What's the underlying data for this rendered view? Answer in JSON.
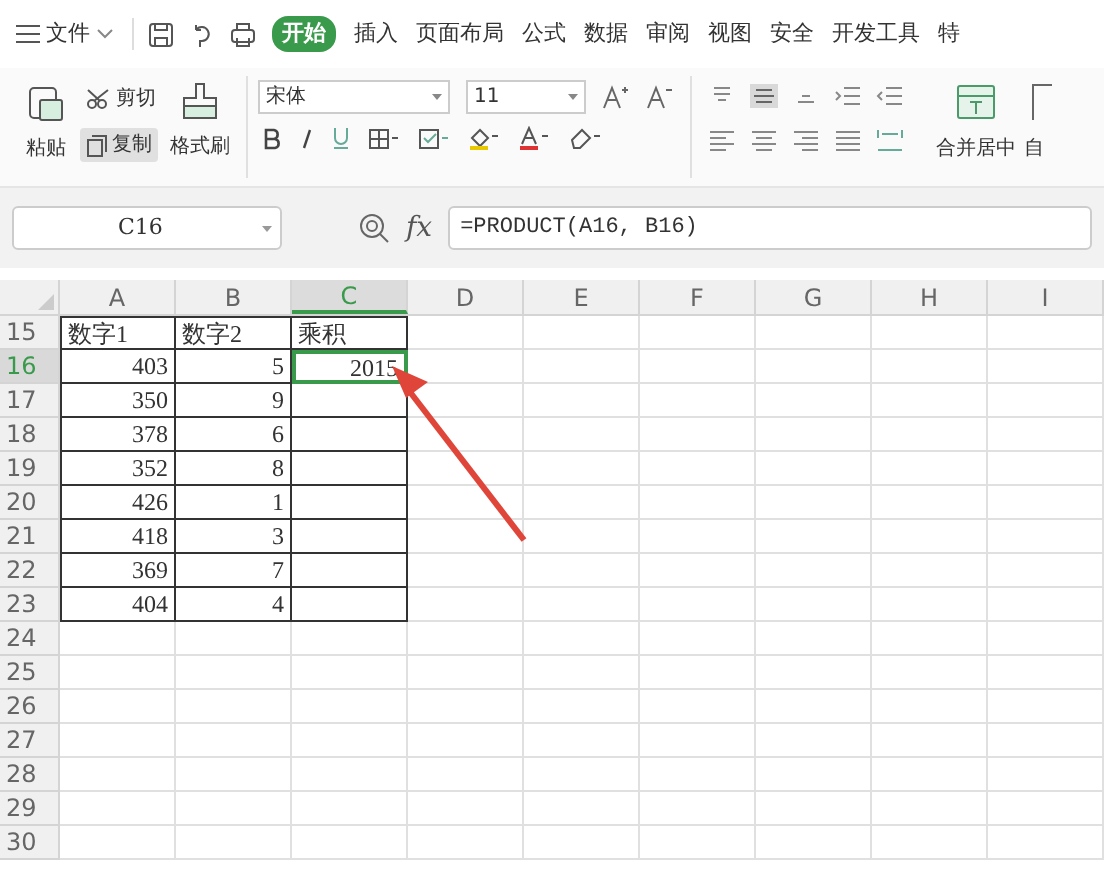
{
  "menu_bar": {
    "file_label": "文件",
    "tabs": [
      {
        "label": "开始",
        "selected": true
      },
      {
        "label": "插入",
        "selected": false
      },
      {
        "label": "页面布局",
        "selected": false
      },
      {
        "label": "公式",
        "selected": false
      },
      {
        "label": "数据",
        "selected": false
      },
      {
        "label": "审阅",
        "selected": false
      },
      {
        "label": "视图",
        "selected": false
      },
      {
        "label": "安全",
        "selected": false
      },
      {
        "label": "开发工具",
        "selected": false
      },
      {
        "label": "特",
        "selected": false
      }
    ]
  },
  "ribbon": {
    "paste": "粘贴",
    "cut": "剪切",
    "copy": "复制",
    "format_painter": "格式刷",
    "font_name": "宋体",
    "font_size": "11",
    "merge_center": "合并居中",
    "auto_wrap": "自"
  },
  "formula_bar": {
    "name_box": "C16",
    "fx_label": "fx",
    "formula": "=PRODUCT(A16, B16)"
  },
  "table": {
    "columns": [
      {
        "label": "A",
        "selected": false
      },
      {
        "label": "B",
        "selected": false
      },
      {
        "label": "C",
        "selected": true
      },
      {
        "label": "D",
        "selected": false
      },
      {
        "label": "E",
        "selected": false
      },
      {
        "label": "F",
        "selected": false
      },
      {
        "label": "G",
        "selected": false
      },
      {
        "label": "H",
        "selected": false
      },
      {
        "label": "I",
        "selected": false
      }
    ],
    "rows": [
      {
        "number": "15",
        "selected": false,
        "bordered": true,
        "kind": "label",
        "cells": [
          "数字1",
          "数字2",
          "乘积"
        ]
      },
      {
        "number": "16",
        "selected": true,
        "bordered": true,
        "kind": "number",
        "cells": [
          "403",
          "5",
          "2015"
        ]
      },
      {
        "number": "17",
        "selected": false,
        "bordered": true,
        "kind": "number",
        "cells": [
          "350",
          "9"
        ]
      },
      {
        "number": "18",
        "selected": false,
        "bordered": true,
        "kind": "number",
        "cells": [
          "378",
          "6"
        ]
      },
      {
        "number": "19",
        "selected": false,
        "bordered": true,
        "kind": "number",
        "cells": [
          "352",
          "8"
        ]
      },
      {
        "number": "20",
        "selected": false,
        "bordered": true,
        "kind": "number",
        "cells": [
          "426",
          "1"
        ]
      },
      {
        "number": "21",
        "selected": false,
        "bordered": true,
        "kind": "number",
        "cells": [
          "418",
          "3"
        ]
      },
      {
        "number": "22",
        "selected": false,
        "bordered": true,
        "kind": "number",
        "cells": [
          "369",
          "7"
        ]
      },
      {
        "number": "23",
        "selected": false,
        "bordered": true,
        "kind": "number",
        "cells": [
          "404",
          "4"
        ]
      },
      {
        "number": "24",
        "selected": false,
        "bordered": false
      },
      {
        "number": "25",
        "selected": false,
        "bordered": false
      },
      {
        "number": "26",
        "selected": false,
        "bordered": false
      },
      {
        "number": "27",
        "selected": false,
        "bordered": false
      },
      {
        "number": "28",
        "selected": false,
        "bordered": false
      },
      {
        "number": "29",
        "selected": false,
        "bordered": false
      },
      {
        "number": "30",
        "selected": false,
        "bordered": false
      }
    ]
  }
}
